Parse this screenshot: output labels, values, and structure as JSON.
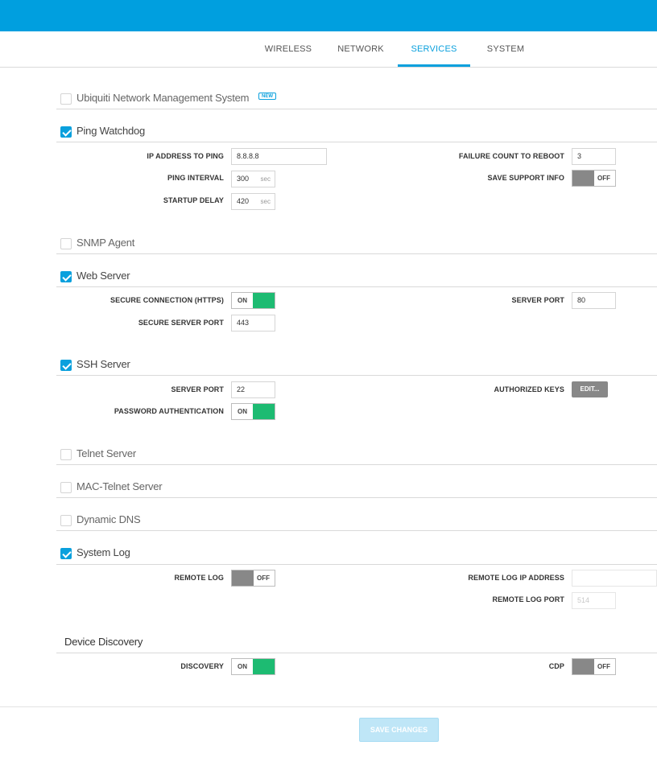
{
  "tabs": [
    {
      "label": "WIRELESS"
    },
    {
      "label": "NETWORK"
    },
    {
      "label": "SERVICES"
    },
    {
      "label": "SYSTEM"
    }
  ],
  "active_tab": "SERVICES",
  "colors": {
    "accent": "#0aa0dd",
    "toggle_on": "#1dbb72",
    "toggle_off": "#888888",
    "header": "#009fdf"
  },
  "nms": {
    "title": "Ubiquiti Network Management System",
    "badge": "NEW",
    "checked": false
  },
  "ping_watchdog": {
    "title": "Ping Watchdog",
    "checked": true,
    "ip_label": "IP ADDRESS TO PING",
    "ip_value": "8.8.8.8",
    "interval_label": "PING INTERVAL",
    "interval_value": "300",
    "interval_unit": "sec",
    "delay_label": "STARTUP DELAY",
    "delay_value": "420",
    "delay_unit": "sec",
    "failure_label": "FAILURE COUNT TO REBOOT",
    "failure_value": "3",
    "support_label": "SAVE SUPPORT INFO",
    "support_state": "OFF"
  },
  "snmp": {
    "title": "SNMP Agent",
    "checked": false
  },
  "web_server": {
    "title": "Web Server",
    "checked": true,
    "https_label": "SECURE CONNECTION (HTTPS)",
    "https_state": "ON",
    "secure_port_label": "SECURE SERVER PORT",
    "secure_port_value": "443",
    "port_label": "SERVER PORT",
    "port_value": "80"
  },
  "ssh_server": {
    "title": "SSH Server",
    "checked": true,
    "port_label": "SERVER PORT",
    "port_value": "22",
    "password_label": "PASSWORD AUTHENTICATION",
    "password_state": "ON",
    "keys_label": "AUTHORIZED KEYS",
    "edit_label": "EDIT..."
  },
  "telnet": {
    "title": "Telnet Server",
    "checked": false
  },
  "mac_telnet": {
    "title": "MAC-Telnet Server",
    "checked": false
  },
  "dyn_dns": {
    "title": "Dynamic DNS",
    "checked": false
  },
  "system_log": {
    "title": "System Log",
    "checked": true,
    "remote_label": "REMOTE LOG",
    "remote_state": "OFF",
    "ip_label": "REMOTE LOG IP ADDRESS",
    "ip_value": "",
    "port_label": "REMOTE LOG PORT",
    "port_value": "514"
  },
  "discovery": {
    "title": "Device Discovery",
    "discovery_label": "DISCOVERY",
    "discovery_state": "ON",
    "cdp_label": "CDP",
    "cdp_state": "OFF"
  },
  "save_label": "SAVE CHANGES"
}
